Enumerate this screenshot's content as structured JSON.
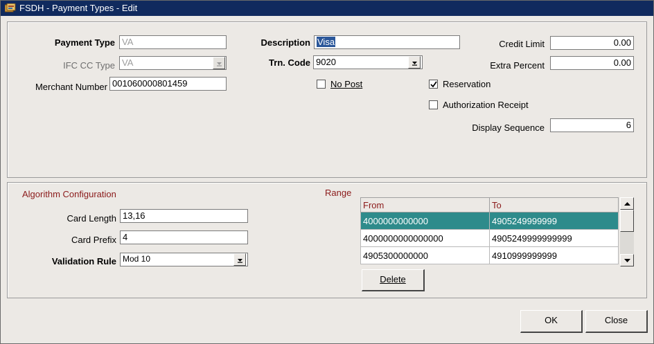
{
  "window": {
    "title": "FSDH - Payment Types - Edit",
    "icon": "app-icon"
  },
  "form": {
    "payment_type": {
      "label": "Payment Type",
      "value": "VA"
    },
    "ifc_cc_type": {
      "label": "IFC CC Type",
      "value": "VA"
    },
    "merchant_number": {
      "label": "Merchant Number",
      "value": "001060000801459"
    },
    "description": {
      "label": "Description",
      "value": "Visa"
    },
    "trn_code": {
      "label": "Trn. Code",
      "value": "9020"
    },
    "no_post": {
      "label": "No Post",
      "checked": false
    },
    "credit_limit": {
      "label": "Credit Limit",
      "value": "0.00"
    },
    "extra_percent": {
      "label": "Extra Percent",
      "value": "0.00"
    },
    "reservation": {
      "label": "Reservation",
      "checked": true
    },
    "authorization_receipt": {
      "label": "Authorization Receipt",
      "checked": false
    },
    "display_sequence": {
      "label": "Display Sequence",
      "value": "6"
    }
  },
  "algorithm": {
    "heading": "Algorithm Configuration",
    "card_length": {
      "label": "Card Length",
      "value": "13,16"
    },
    "card_prefix": {
      "label": "Card Prefix",
      "value": "4"
    },
    "validation_rule": {
      "label": "Validation Rule",
      "value": "Mod 10"
    }
  },
  "range": {
    "heading": "Range",
    "columns": [
      "From",
      "To"
    ],
    "rows": [
      {
        "from": "4000000000000",
        "to": "4905249999999",
        "selected": true
      },
      {
        "from": "4000000000000000",
        "to": "4905249999999999",
        "selected": false
      },
      {
        "from": "4905300000000",
        "to": "4910999999999",
        "selected": false
      }
    ],
    "delete_label": "Delete"
  },
  "footer": {
    "ok_label": "OK",
    "close_label": "Close"
  },
  "colors": {
    "titlebar": "#102a5e",
    "selected_row": "#2e8b8b",
    "section_heading": "#8b1a1a",
    "window_bg": "#ece9e5"
  }
}
